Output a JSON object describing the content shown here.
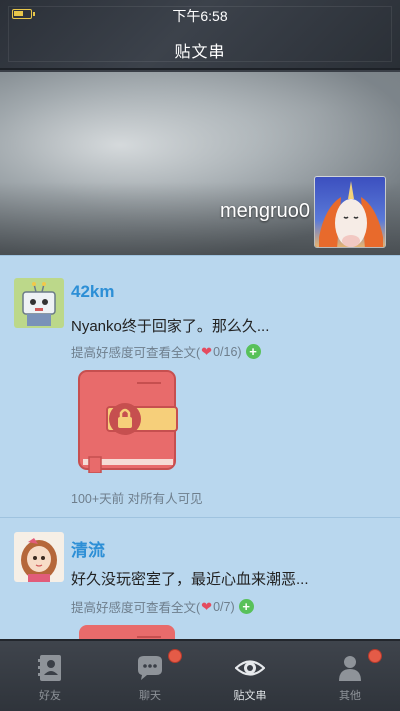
{
  "status": {
    "time": "下午6:58"
  },
  "header": {
    "title": "贴文串"
  },
  "banner": {
    "username": "mengruo0"
  },
  "posts": [
    {
      "name": "42km",
      "text": "Nyanko终于回家了。那么久...",
      "hint_prefix": "提高好感度可查看全文(",
      "favor": "0/16",
      "hint_suffix": ")",
      "meta": "100+天前  对所有人可见"
    },
    {
      "name": "清流",
      "text": "好久没玩密室了，最近心血来潮恶...",
      "hint_prefix": "提高好感度可查看全文(",
      "favor": "0/7",
      "hint_suffix": ")"
    }
  ],
  "nav": {
    "items": [
      {
        "label": "好友",
        "icon": "contacts-icon"
      },
      {
        "label": "聊天",
        "icon": "chat-icon"
      },
      {
        "label": "贴文串",
        "icon": "eye-icon"
      },
      {
        "label": "其他",
        "icon": "person-icon"
      }
    ]
  },
  "colors": {
    "name_blue": "#2d8fd6",
    "feed_bg": "#b9d7ee",
    "heart": "#e44b5f",
    "plus": "#58c15a",
    "badge": "#e45b47"
  }
}
